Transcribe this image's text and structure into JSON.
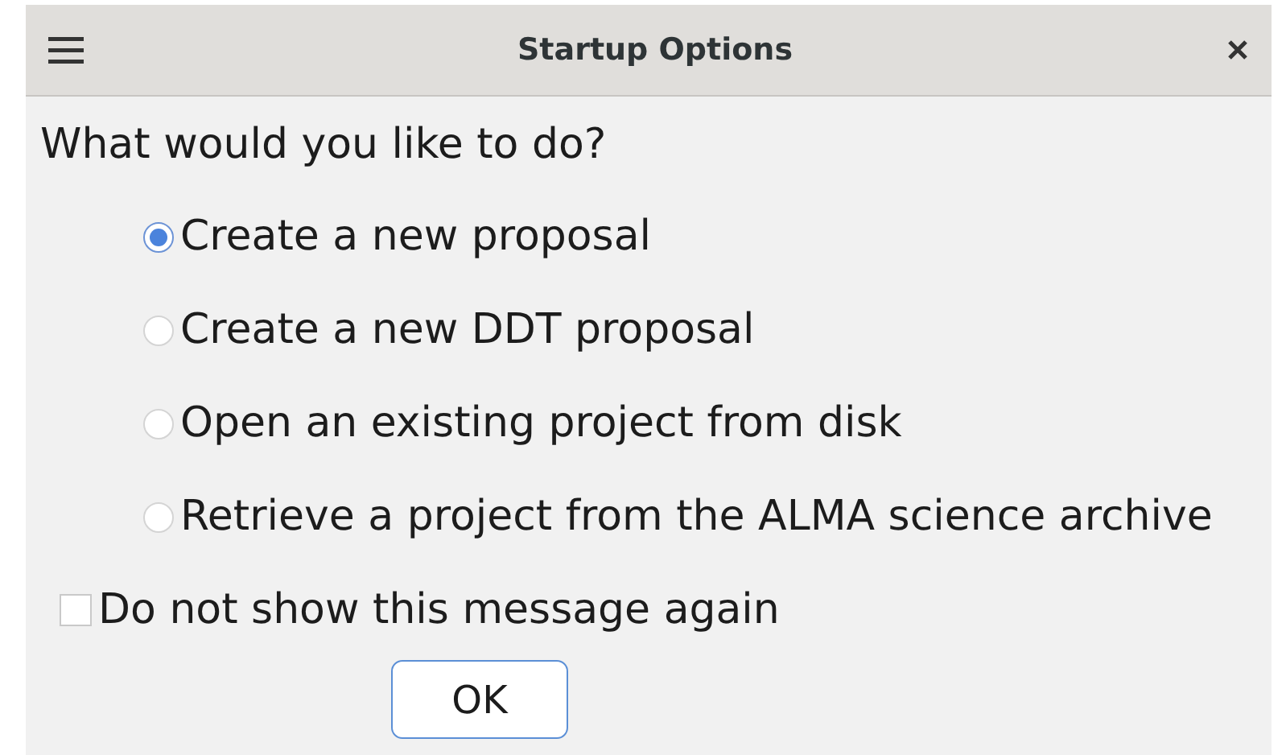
{
  "window": {
    "title": "Startup Options"
  },
  "prompt": "What would you like to do?",
  "options": [
    {
      "label": "Create a new proposal",
      "selected": true
    },
    {
      "label": "Create a new DDT proposal",
      "selected": false
    },
    {
      "label": "Open an existing project from disk",
      "selected": false
    },
    {
      "label": "Retrieve a project from the ALMA science archive",
      "selected": false
    }
  ],
  "dont_show_again": {
    "label": "Do not show this message again",
    "checked": false
  },
  "buttons": [
    "OK"
  ]
}
